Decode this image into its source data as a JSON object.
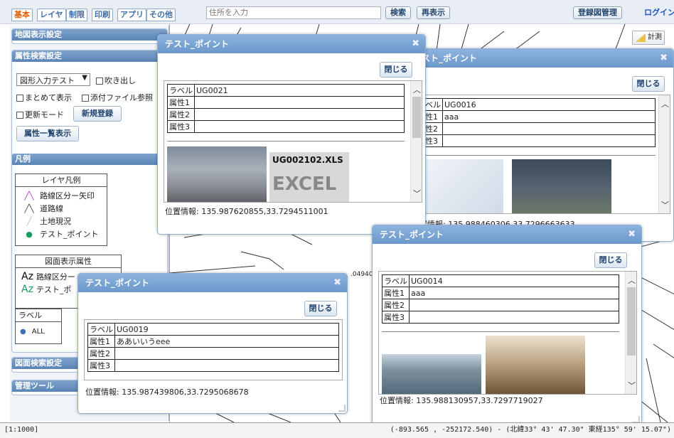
{
  "tabs": [
    "基本",
    "レイヤ",
    "制限",
    "印刷",
    "アプリ",
    "その他"
  ],
  "search": {
    "placeholder": "住所を入力",
    "search_label": "検索",
    "redisplay_label": "再表示"
  },
  "header": {
    "register_label": "登録図管理",
    "login_label": "ログイン"
  },
  "map_tools": {
    "measure_label": "計測",
    "map_label_text": ".04940"
  },
  "panels": {
    "map_display": "地図表示設定",
    "attr_search": {
      "title": "属性検索設定",
      "select_value": "図形入力テスト",
      "balloon_label": "吹き出し",
      "group_label": "まとめて表示",
      "attach_label": "添付ファイル参照",
      "update_label": "更新モード",
      "new_label": "新規登録",
      "list_label": "属性一覧表示"
    },
    "legend": {
      "title": "凡例",
      "layer_title": "レイヤ凡例",
      "layer_items": [
        "路線区分ー矢印",
        "道路線",
        "土地現況",
        "テスト_ポイント"
      ],
      "draw_title": "図面表示属性",
      "draw_items": [
        "路線区分ー",
        "テスト_ポ"
      ],
      "label_title": "ラベル",
      "label_items": [
        "ALL"
      ]
    },
    "drawing_search": "図面検索設定",
    "admin_tool": "管理ツール"
  },
  "dialogs": [
    {
      "title": "テスト_ポイント",
      "close_label": "閉じる",
      "rows": [
        [
          "ラベル",
          "UG0021"
        ],
        [
          "属性1",
          ""
        ],
        [
          "属性2",
          ""
        ],
        [
          "属性3",
          ""
        ]
      ],
      "file_label": "UG002102.XLS",
      "file_type": "EXCEL",
      "pos_label": "位置情報:",
      "pos_value": "135.987620855,33.7294511001"
    },
    {
      "title": "テスト_ポイント",
      "close_label": "閉じる",
      "rows": [
        [
          "ラベル",
          "UG0016"
        ],
        [
          "属性1",
          "aaa"
        ],
        [
          "属性2",
          ""
        ],
        [
          "属性3",
          ""
        ]
      ],
      "pos_label": "位置情報:",
      "pos_value": "135.988460306,33.7296663633"
    },
    {
      "title": "テスト_ポイント",
      "close_label": "閉じる",
      "rows": [
        [
          "ラベル",
          "UG0014"
        ],
        [
          "属性1",
          "aaa"
        ],
        [
          "属性2",
          ""
        ],
        [
          "属性3",
          ""
        ]
      ],
      "pos_label": "位置情報:",
      "pos_value": "135.988130957,33.7297719027"
    },
    {
      "title": "テスト_ポイント",
      "close_label": "閉じる",
      "rows": [
        [
          "ラベル",
          "UG0019"
        ],
        [
          "属性1",
          "ああいいうeee"
        ],
        [
          "属性2",
          ""
        ],
        [
          "属性3",
          ""
        ]
      ],
      "pos_label": "位置情報:",
      "pos_value": "135.987439806,33.7295068678"
    }
  ],
  "status": {
    "scale": "[1:1000]",
    "coords": "(-893.565 , -252172.540) - (北緯33° 43' 47.30\" 東経135° 59' 15.07\")"
  },
  "icons": [
    "close-icon",
    "measure-icon",
    "chevron-down-icon",
    "scroll-up-icon",
    "scroll-down-icon",
    "resize-grip-icon",
    "route-arrow-icon",
    "road-line-icon",
    "land-status-icon",
    "point-icon"
  ],
  "colors": {
    "header_blue": "#6b97cb",
    "tab_active": "#e35b00",
    "link_blue": "#1d55c4"
  }
}
